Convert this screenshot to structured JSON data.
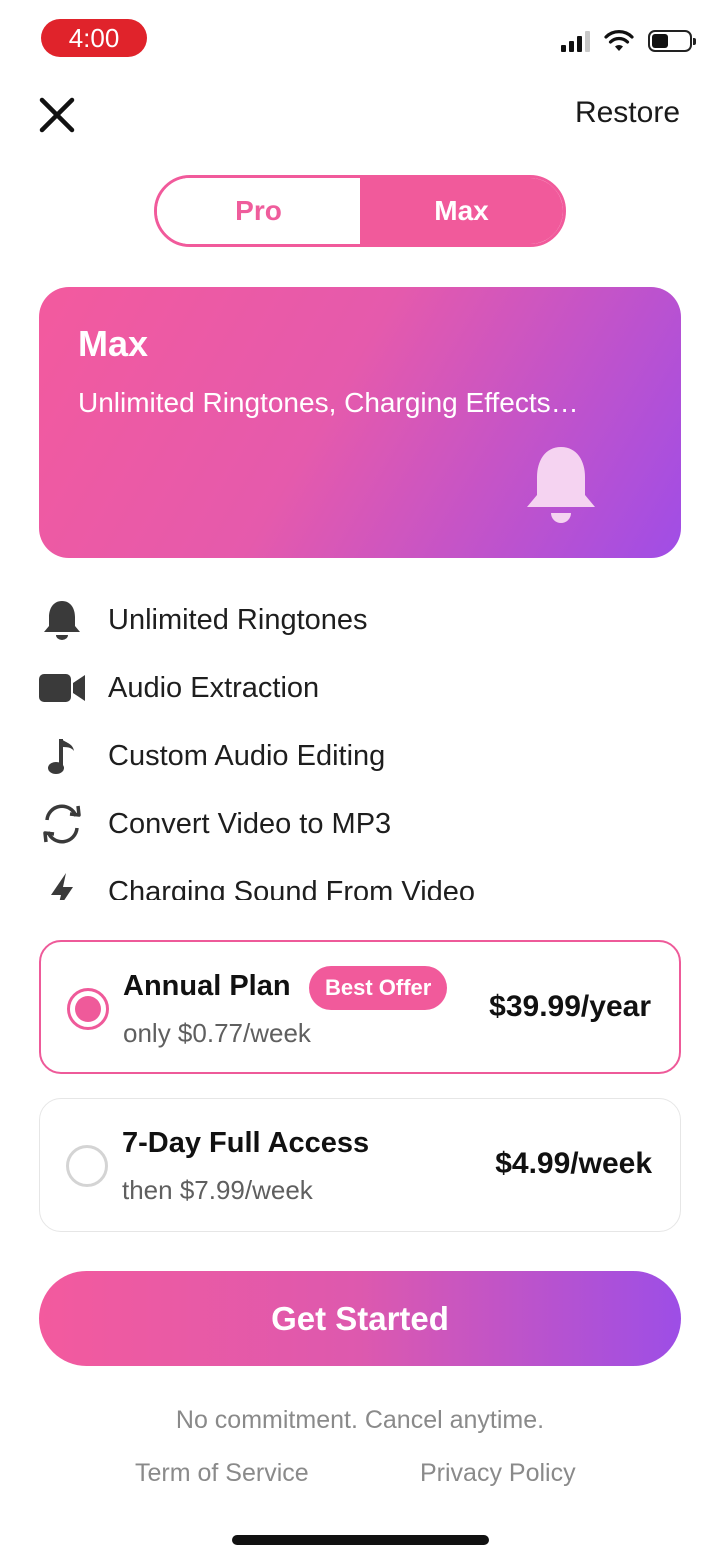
{
  "status_bar": {
    "time": "4:00"
  },
  "top_bar": {
    "restore_label": "Restore"
  },
  "segmented": {
    "pro_label": "Pro",
    "max_label": "Max",
    "selected": "Max"
  },
  "hero": {
    "title": "Max",
    "subtitle": "Unlimited Ringtones, Charging Effects…",
    "icon": "bell-icon"
  },
  "features": [
    {
      "icon": "bell-icon",
      "label": "Unlimited Ringtones"
    },
    {
      "icon": "video-camera-icon",
      "label": "Audio Extraction"
    },
    {
      "icon": "music-note-icon",
      "label": "Custom Audio Editing"
    },
    {
      "icon": "convert-arrows-icon",
      "label": "Convert Video to MP3"
    },
    {
      "icon": "lightning-icon",
      "label": "Charging Sound From Video"
    }
  ],
  "plans": [
    {
      "name": "Annual Plan",
      "badge": "Best Offer",
      "note": "only $0.77/week",
      "price": "$39.99/year",
      "selected": true
    },
    {
      "name": "7-Day Full Access",
      "note": "then $7.99/week",
      "price": "$4.99/week",
      "selected": false
    }
  ],
  "cta": {
    "label": "Get Started"
  },
  "footer": {
    "note": "No commitment. Cancel anytime.",
    "terms_label": "Term of Service",
    "privacy_label": "Privacy Policy"
  },
  "colors": {
    "accent_pink": "#f15a9b",
    "accent_purple": "#9d4ee6",
    "status_red": "#e0232b"
  }
}
